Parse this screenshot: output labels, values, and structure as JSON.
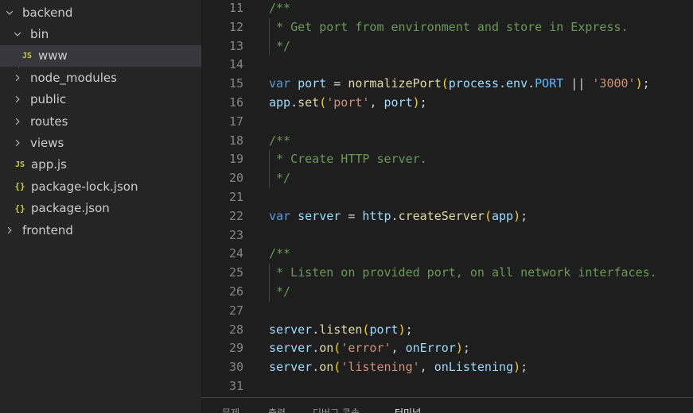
{
  "explorer": {
    "items": [
      {
        "label": "backend",
        "kind": "folder-open",
        "depth": 0
      },
      {
        "label": "bin",
        "kind": "folder-open",
        "depth": 1
      },
      {
        "label": "www",
        "kind": "js",
        "depth": 2,
        "icon_text": "JS",
        "selected": true
      },
      {
        "label": "node_modules",
        "kind": "folder",
        "depth": 1
      },
      {
        "label": "public",
        "kind": "folder",
        "depth": 1
      },
      {
        "label": "routes",
        "kind": "folder",
        "depth": 1
      },
      {
        "label": "views",
        "kind": "folder",
        "depth": 1
      },
      {
        "label": "app.js",
        "kind": "js",
        "depth": 1,
        "icon_text": "JS"
      },
      {
        "label": "package-lock.json",
        "kind": "json",
        "depth": 1,
        "icon_text": "{}"
      },
      {
        "label": "package.json",
        "kind": "json",
        "depth": 1,
        "icon_text": "{}"
      },
      {
        "label": "frontend",
        "kind": "folder",
        "depth": 0
      }
    ]
  },
  "editor": {
    "lines": [
      {
        "n": "11",
        "comment_block": true,
        "tokens": [
          [
            "comment",
            "/**"
          ]
        ]
      },
      {
        "n": "12",
        "comment_block": true,
        "tokens": [
          [
            "comment",
            " * Get port from environment and store in Express."
          ]
        ]
      },
      {
        "n": "13",
        "comment_block": true,
        "tokens": [
          [
            "comment",
            " */"
          ]
        ]
      },
      {
        "n": "14",
        "tokens": []
      },
      {
        "n": "15",
        "tokens": [
          [
            "keyword",
            "var"
          ],
          [
            "punct",
            " "
          ],
          [
            "variable",
            "port"
          ],
          [
            "punct",
            " = "
          ],
          [
            "function",
            "normalizePort"
          ],
          [
            "bracket",
            "("
          ],
          [
            "variable",
            "process"
          ],
          [
            "punct",
            "."
          ],
          [
            "variable",
            "env"
          ],
          [
            "punct",
            "."
          ],
          [
            "constant",
            "PORT"
          ],
          [
            "punct",
            " || "
          ],
          [
            "string",
            "'3000'"
          ],
          [
            "bracket",
            ")"
          ],
          [
            "punct",
            ";"
          ]
        ]
      },
      {
        "n": "16",
        "tokens": [
          [
            "variable",
            "app"
          ],
          [
            "punct",
            "."
          ],
          [
            "function",
            "set"
          ],
          [
            "bracket",
            "("
          ],
          [
            "string",
            "'port'"
          ],
          [
            "punct",
            ", "
          ],
          [
            "variable",
            "port"
          ],
          [
            "bracket",
            ")"
          ],
          [
            "punct",
            ";"
          ]
        ]
      },
      {
        "n": "17",
        "tokens": []
      },
      {
        "n": "18",
        "comment_block": true,
        "tokens": [
          [
            "comment",
            "/**"
          ]
        ]
      },
      {
        "n": "19",
        "comment_block": true,
        "tokens": [
          [
            "comment",
            " * Create HTTP server."
          ]
        ]
      },
      {
        "n": "20",
        "comment_block": true,
        "tokens": [
          [
            "comment",
            " */"
          ]
        ]
      },
      {
        "n": "21",
        "tokens": []
      },
      {
        "n": "22",
        "tokens": [
          [
            "keyword",
            "var"
          ],
          [
            "punct",
            " "
          ],
          [
            "variable",
            "server"
          ],
          [
            "punct",
            " = "
          ],
          [
            "variable",
            "http"
          ],
          [
            "punct",
            "."
          ],
          [
            "function",
            "createServer"
          ],
          [
            "bracket",
            "("
          ],
          [
            "variable",
            "app"
          ],
          [
            "bracket",
            ")"
          ],
          [
            "punct",
            ";"
          ]
        ]
      },
      {
        "n": "23",
        "tokens": []
      },
      {
        "n": "24",
        "comment_block": true,
        "tokens": [
          [
            "comment",
            "/**"
          ]
        ]
      },
      {
        "n": "25",
        "comment_block": true,
        "tokens": [
          [
            "comment",
            " * Listen on provided port, on all network interfaces."
          ]
        ]
      },
      {
        "n": "26",
        "comment_block": true,
        "tokens": [
          [
            "comment",
            " */"
          ]
        ]
      },
      {
        "n": "27",
        "tokens": []
      },
      {
        "n": "28",
        "tokens": [
          [
            "variable",
            "server"
          ],
          [
            "punct",
            "."
          ],
          [
            "function",
            "listen"
          ],
          [
            "bracket",
            "("
          ],
          [
            "variable",
            "port"
          ],
          [
            "bracket",
            ")"
          ],
          [
            "punct",
            ";"
          ]
        ]
      },
      {
        "n": "29",
        "tokens": [
          [
            "variable",
            "server"
          ],
          [
            "punct",
            "."
          ],
          [
            "function",
            "on"
          ],
          [
            "bracket",
            "("
          ],
          [
            "string",
            "'error'"
          ],
          [
            "punct",
            ", "
          ],
          [
            "variable",
            "onError"
          ],
          [
            "bracket",
            ")"
          ],
          [
            "punct",
            ";"
          ]
        ]
      },
      {
        "n": "30",
        "tokens": [
          [
            "variable",
            "server"
          ],
          [
            "punct",
            "."
          ],
          [
            "function",
            "on"
          ],
          [
            "bracket",
            "("
          ],
          [
            "string",
            "'listening'"
          ],
          [
            "punct",
            ", "
          ],
          [
            "variable",
            "onListening"
          ],
          [
            "bracket",
            ")"
          ],
          [
            "punct",
            ";"
          ]
        ]
      },
      {
        "n": "31",
        "tokens": []
      }
    ]
  },
  "panel": {
    "tabs": [
      {
        "label": "문제"
      },
      {
        "label": "출력"
      },
      {
        "label": "디버그 콘솔"
      },
      {
        "label": "터미널",
        "active": true
      }
    ]
  },
  "colors": {
    "sidebar_bg": "#252526",
    "editor_bg": "#1e1e1e",
    "selection_bg": "#37373d",
    "comment": "#6a9955",
    "keyword": "#569cd6",
    "variable": "#9cdcfe",
    "function": "#dcdcaa",
    "string": "#ce9178",
    "constant": "#4fc1ff",
    "bracket": "#ffd700"
  }
}
